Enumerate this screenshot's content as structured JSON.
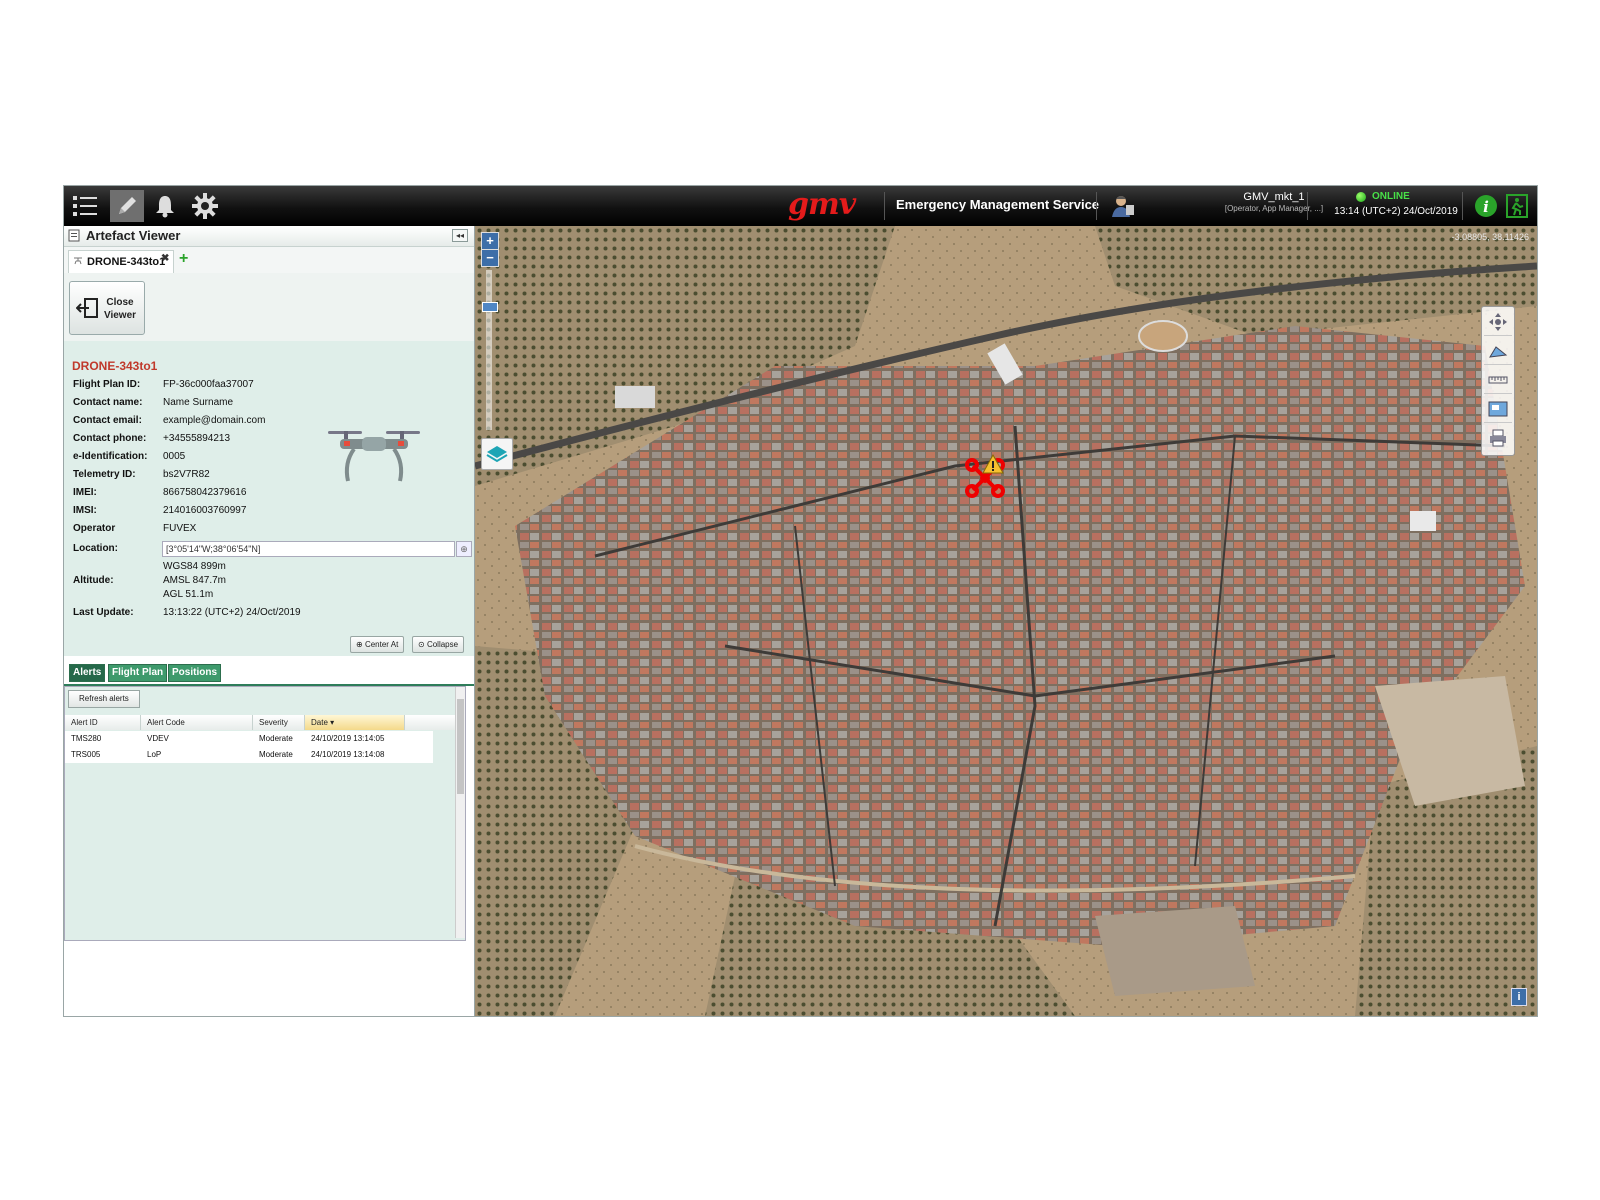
{
  "header": {
    "logo_text": "gmv",
    "service_title": "Emergency Management Service",
    "user_name": "GMV_mkt_1",
    "user_roles": "[Operator, App Manager, ...]",
    "status": "ONLINE",
    "datetime": "13:14 (UTC+2) 24/Oct/2019",
    "icons": [
      "list-icon",
      "pencil-icon",
      "bell-icon",
      "gear-icon",
      "user-icon",
      "info-icon",
      "exit-icon"
    ]
  },
  "panel": {
    "title": "Artefact Viewer",
    "tab_label": "DRONE-343to1",
    "close_button": "Close Viewer"
  },
  "drone": {
    "title": "DRONE-343to1",
    "fields": [
      {
        "key": "Flight Plan ID:",
        "value": "FP-36c000faa37007"
      },
      {
        "key": "Contact name:",
        "value": "Name Surname"
      },
      {
        "key": "Contact email:",
        "value": "example@domain.com"
      },
      {
        "key": "Contact phone:",
        "value": "+34555894213"
      },
      {
        "key": "e-Identification:",
        "value": "0005"
      },
      {
        "key": "Telemetry ID:",
        "value": "bs2V7R82"
      },
      {
        "key": "IMEI:",
        "value": "866758042379616"
      },
      {
        "key": "IMSI:",
        "value": "214016003760997"
      },
      {
        "key": "Operator",
        "value": "FUVEX"
      }
    ],
    "location_label": "Location:",
    "location_value": "[3°05'14\"W;38°06'54\"N]",
    "altitude_label": "Altitude:",
    "altitude_lines": [
      "WGS84  899m",
      "AMSL   847.7m",
      "AGL      51.1m"
    ],
    "last_update_label": "Last Update:",
    "last_update_value": "13:13:22 (UTC+2) 24/Oct/2019",
    "center_at": "Center At",
    "collapse": "Collapse"
  },
  "lower_tabs": [
    "Alerts",
    "Flight Plan",
    "Positions"
  ],
  "alerts": {
    "refresh": "Refresh alerts",
    "columns": [
      "Alert ID",
      "Alert Code",
      "Severity",
      "Date"
    ],
    "rows": [
      [
        "TMS280",
        "VDEV",
        "Moderate",
        "24/10/2019 13:14:05"
      ],
      [
        "TRS005",
        "LoP",
        "Moderate",
        "24/10/2019 13:14:08"
      ]
    ]
  },
  "map": {
    "coord_readout": "-3.08805, 38.11426",
    "zoom_in": "+",
    "zoom_out": "−",
    "info": "i"
  },
  "colors": {
    "accent": "#3e9a6c",
    "brand": "#e31b1b",
    "online": "#18a818",
    "panel_bg": "#dfeee9"
  }
}
